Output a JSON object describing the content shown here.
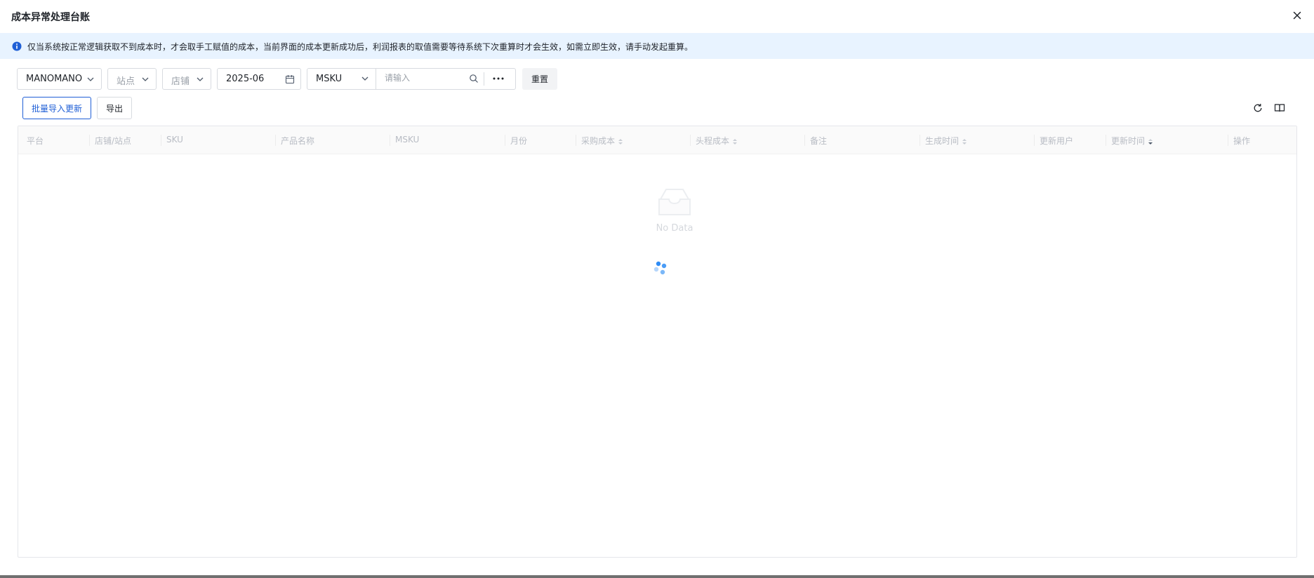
{
  "modal": {
    "title": "成本异常处理台账"
  },
  "notice": {
    "text": "仅当系统按正常逻辑获取不到成本时，才会取手工赋值的成本，当前界面的成本更新成功后，利润报表的取值需要等待系统下次重算时才会生效，如需立即生效，请手动发起重算。"
  },
  "filters": {
    "platform": "MANOMANO",
    "site_placeholder": "站点",
    "store_placeholder": "店铺",
    "month": "2025-06",
    "field_select": "MSKU",
    "search_placeholder": "请输入",
    "reset_label": "重置"
  },
  "actions": {
    "batch_import_label": "批量导入更新",
    "export_label": "导出"
  },
  "table": {
    "columns": [
      {
        "label": "平台",
        "sortable": false
      },
      {
        "label": "店铺/站点",
        "sortable": false
      },
      {
        "label": "SKU",
        "sortable": false
      },
      {
        "label": "产品名称",
        "sortable": false
      },
      {
        "label": "MSKU",
        "sortable": false
      },
      {
        "label": "月份",
        "sortable": false
      },
      {
        "label": "采购成本",
        "sortable": true
      },
      {
        "label": "头程成本",
        "sortable": true
      },
      {
        "label": "备注",
        "sortable": false
      },
      {
        "label": "生成时间",
        "sortable": true
      },
      {
        "label": "更新用户",
        "sortable": false
      },
      {
        "label": "更新时间",
        "sortable": true,
        "sorted": "desc"
      },
      {
        "label": "操作",
        "sortable": false
      }
    ],
    "rows": [],
    "empty_text": "No Data",
    "loading": true
  },
  "icons": {
    "info": "info-circle-icon",
    "close": "close-icon",
    "chevron": "chevron-down-icon",
    "calendar": "calendar-icon",
    "search": "search-icon",
    "more": "more-horizontal-icon",
    "refresh": "refresh-icon",
    "columns": "column-settings-icon",
    "empty": "empty-inbox-icon",
    "spinner": "loading-spinner-icon"
  },
  "colors": {
    "primary": "#1f5fd6",
    "notice_bg": "#e8f3ff",
    "spinner": "#2f8cf5"
  }
}
